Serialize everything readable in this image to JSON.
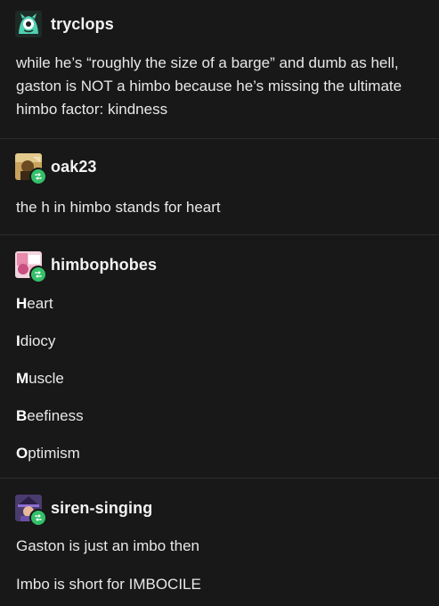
{
  "posts": [
    {
      "username": "tryclops",
      "avatar_icon": "teal-monster-avatar-icon",
      "text": "while he’s “roughly the size of a barge” and dumb as hell, gaston is NOT a himbo because he’s missing the ultimate himbo factor: kindness"
    },
    {
      "username": "oak23",
      "avatar_icon": "sepia-photo-avatar-icon",
      "reblog_icon": "reblog-icon",
      "text": "the h in himbo stands for heart"
    },
    {
      "username": "himbophobes",
      "avatar_icon": "pink-collage-avatar-icon",
      "reblog_icon": "reblog-icon",
      "acrostic": [
        {
          "initial": "H",
          "rest": "eart"
        },
        {
          "initial": "I",
          "rest": "diocy"
        },
        {
          "initial": "M",
          "rest": "uscle"
        },
        {
          "initial": "B",
          "rest": "eefiness"
        },
        {
          "initial": "O",
          "rest": "ptimism"
        }
      ]
    },
    {
      "username": "siren-singing",
      "avatar_icon": "purple-hat-avatar-icon",
      "reblog_icon": "reblog-icon",
      "lines": [
        "Gaston is just an imbo then",
        "Imbo is short for IMBOCILE"
      ]
    }
  ],
  "colors": {
    "background": "#181818",
    "text": "#ececec",
    "divider": "#2e2e2e",
    "reblog_green": "#34c06a"
  }
}
